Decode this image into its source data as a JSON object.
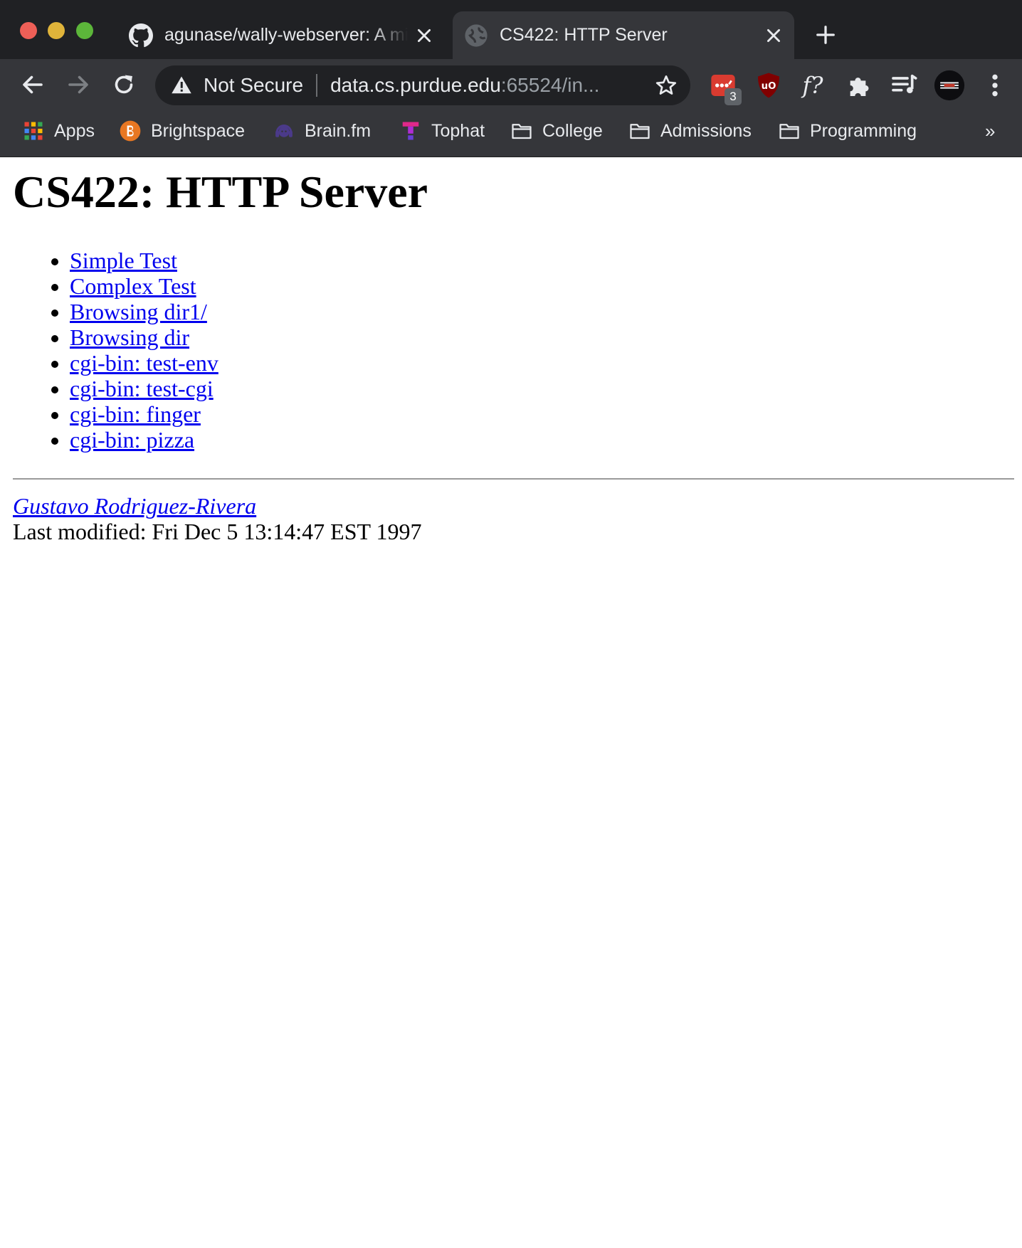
{
  "tabs": [
    {
      "title": "agunase/wally-webserver: A minimal webserver",
      "favicon": "github-icon",
      "active": false
    },
    {
      "title": "CS422: HTTP Server",
      "favicon": "globe-icon",
      "active": true
    }
  ],
  "toolbar": {
    "security_label": "Not Secure",
    "url_host": "data.cs.purdue.edu",
    "url_rest": ":65524/in...",
    "extension_badge": "3",
    "fquery_label": "f?"
  },
  "bookmarks": [
    {
      "label": "Apps",
      "icon": "apps-grid-icon"
    },
    {
      "label": "Brightspace",
      "icon": "brightspace-icon"
    },
    {
      "label": "Brain.fm",
      "icon": "brainfm-icon"
    },
    {
      "label": "Tophat",
      "icon": "tophat-icon"
    },
    {
      "label": "College",
      "icon": "folder-icon"
    },
    {
      "label": "Admissions",
      "icon": "folder-icon"
    },
    {
      "label": "Programming",
      "icon": "folder-icon"
    }
  ],
  "bookmarks_overflow": "»",
  "page": {
    "heading": "CS422: HTTP Server",
    "links": [
      "Simple Test",
      "Complex Test",
      "Browsing dir1/",
      "Browsing dir",
      "cgi-bin: test-env",
      "cgi-bin: test-cgi",
      "cgi-bin: finger",
      "cgi-bin: pizza"
    ],
    "author": "Gustavo Rodriguez-Rivera",
    "last_modified": "Last modified: Fri Dec 5 13:14:47 EST 1997"
  },
  "colors": {
    "chrome_dark": "#202124",
    "chrome_toolbar": "#35363a",
    "link": "#0000ee",
    "traffic_red": "#ee5f57",
    "traffic_yellow": "#e0b43a",
    "traffic_green": "#5cb63a"
  }
}
